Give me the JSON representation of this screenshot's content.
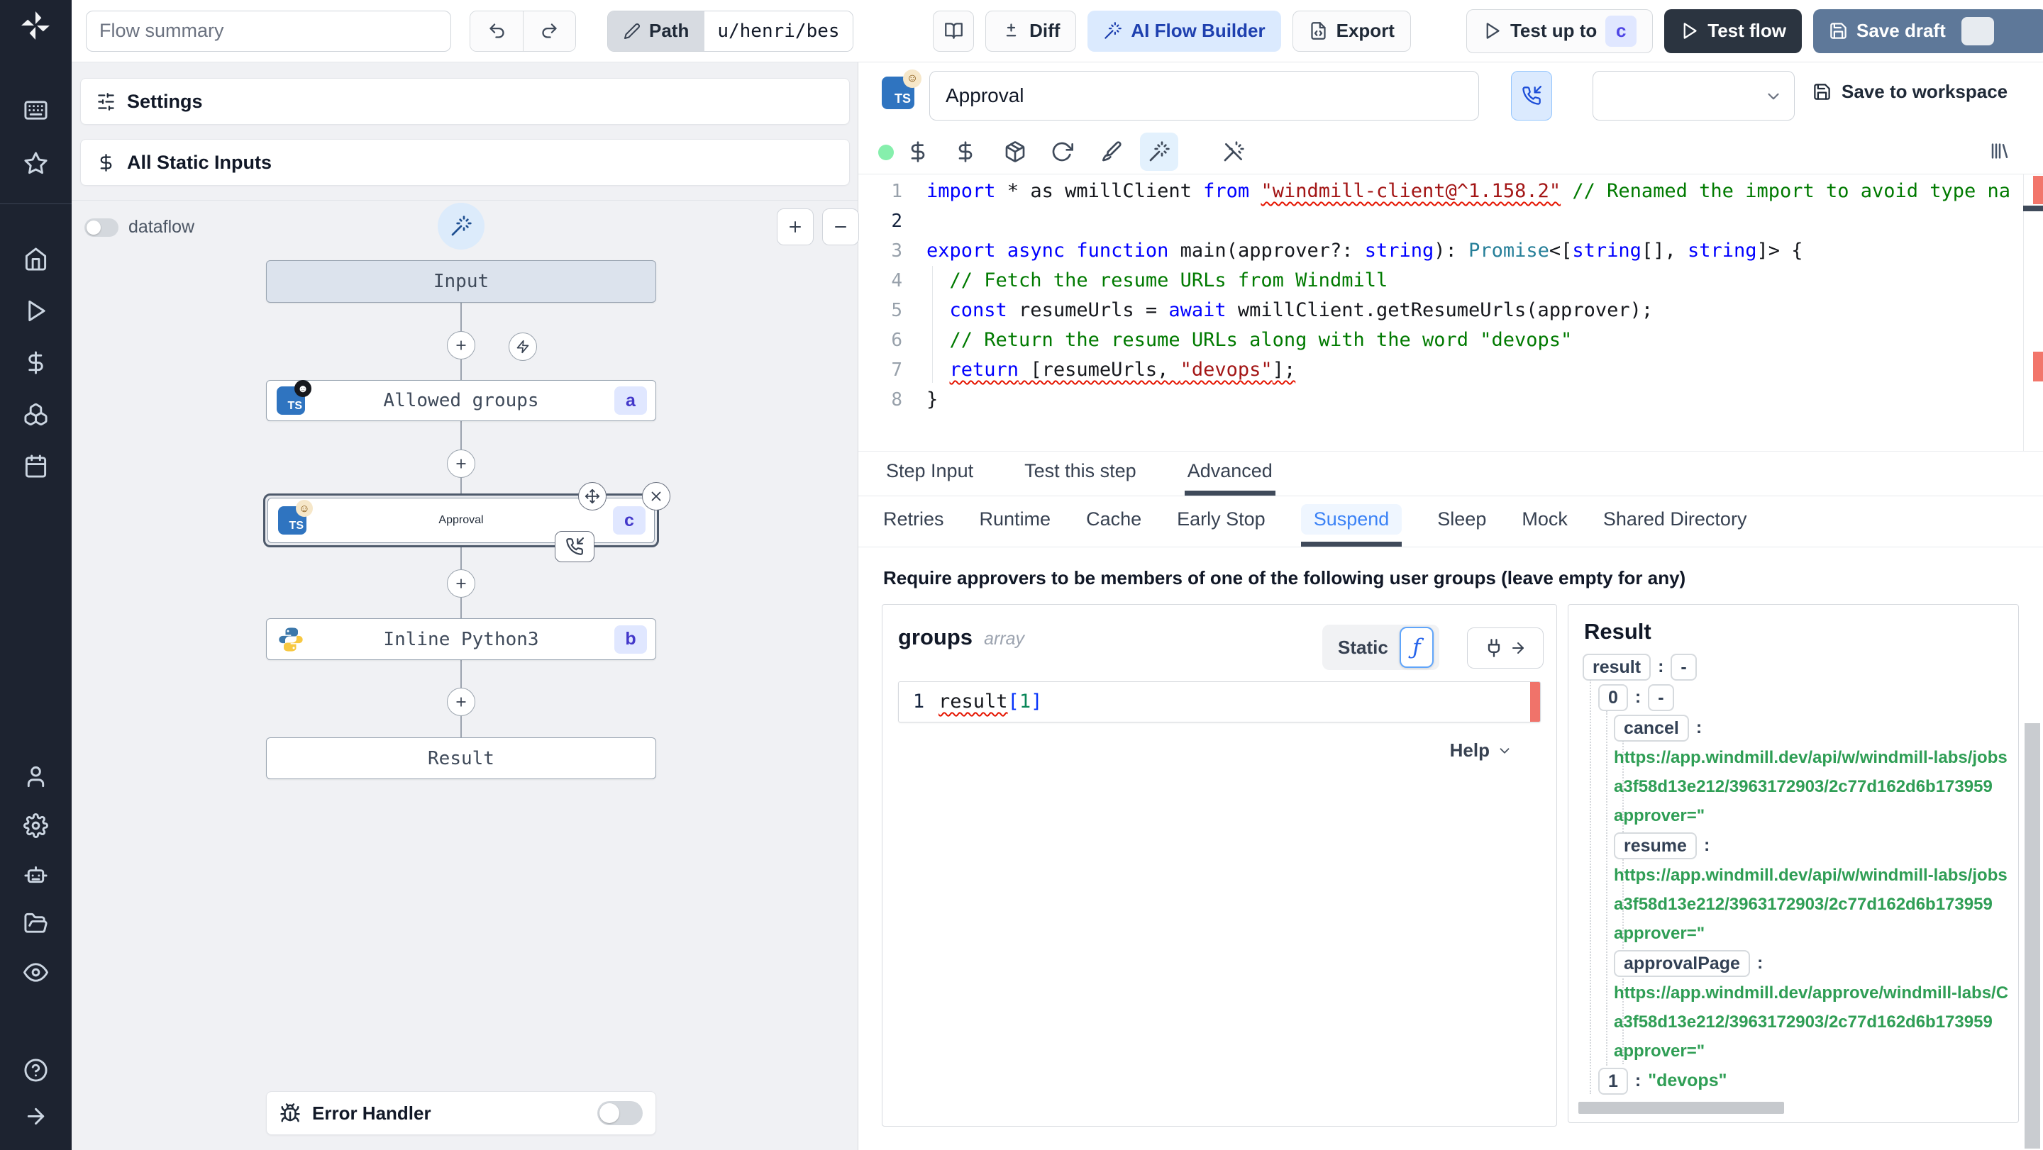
{
  "colors": {
    "accent_blue": "#3b82f6",
    "ai_button_bg": "#dbeafe",
    "ai_button_text": "#1e40af",
    "badge_bg": "#e0e7ff",
    "badge_text": "#4f46e5",
    "test_flow_bg": "#2b3440",
    "save_draft_bg": "#5e7899",
    "status_dot_green": "#86efac",
    "code_keyword": "#0000ff",
    "code_string": "#a31515",
    "code_comment": "#007a00",
    "code_type": "#267f99",
    "url_green": "#2f9e55",
    "error_red": "#e51400"
  },
  "sidebar": {
    "groups": [
      [
        "apps",
        "star"
      ],
      [
        "home",
        "play",
        "dollar",
        "boxes",
        "calendar"
      ],
      [
        "user",
        "gear",
        "robot",
        "folder",
        "eye"
      ],
      [
        "help",
        "arrow-right"
      ]
    ]
  },
  "topbar": {
    "flow_summary_placeholder": "Flow summary",
    "path": {
      "label": "Path",
      "value": "u/henri/bes"
    },
    "buttons": {
      "diff": "Diff",
      "ai_flow_builder": "AI Flow Builder",
      "export": "Export",
      "test_up_to": "Test up to",
      "test_up_to_badge": "c",
      "test_flow": "Test flow",
      "save_draft": "Save draft"
    }
  },
  "flow_panel": {
    "settings_label": "Settings",
    "static_inputs_label": "All Static Inputs",
    "dataflow_label": "dataflow",
    "input_node_label": "Input",
    "result_node_label": "Result",
    "steps": [
      {
        "label": "Allowed groups",
        "badge": "a",
        "lang": "typescript"
      },
      {
        "label": "Approval",
        "badge": "c",
        "lang": "typescript"
      },
      {
        "label": "Inline Python3",
        "badge": "b",
        "lang": "python"
      }
    ],
    "error_handler_label": "Error Handler"
  },
  "step_editor": {
    "name_value": "Approval",
    "save_to_workspace_label": "Save to workspace",
    "toolbar_icons": [
      "dollar",
      "dollar",
      "package",
      "refresh",
      "brush",
      "wand",
      "wand-off"
    ],
    "toolbar_active_index": 5,
    "code": {
      "lines": [
        {
          "segs": [
            {
              "t": "import",
              "c": "kw"
            },
            {
              "t": " * as wmillClient ",
              "c": "pl"
            },
            {
              "t": "from",
              "c": "kw"
            },
            {
              "t": " ",
              "c": "pl"
            },
            {
              "t": "\"windmill-client@^1.158.2\"",
              "c": "str sq"
            },
            {
              "t": " ",
              "c": "pl"
            },
            {
              "t": "// Renamed the import to avoid type na",
              "c": "com"
            }
          ]
        },
        {
          "segs": []
        },
        {
          "segs": [
            {
              "t": "export",
              "c": "kw"
            },
            {
              "t": " ",
              "c": "pl"
            },
            {
              "t": "async",
              "c": "kw"
            },
            {
              "t": " ",
              "c": "pl"
            },
            {
              "t": "function",
              "c": "kw"
            },
            {
              "t": " main(approver?: ",
              "c": "pl"
            },
            {
              "t": "string",
              "c": "kw"
            },
            {
              "t": "): ",
              "c": "pl"
            },
            {
              "t": "Promise",
              "c": "type"
            },
            {
              "t": "<[",
              "c": "pl"
            },
            {
              "t": "string",
              "c": "kw"
            },
            {
              "t": "[], ",
              "c": "pl"
            },
            {
              "t": "string",
              "c": "kw"
            },
            {
              "t": "]> {",
              "c": "pl"
            }
          ]
        },
        {
          "segs": [
            {
              "t": "  // Fetch the resume URLs from Windmill",
              "c": "com"
            }
          ]
        },
        {
          "segs": [
            {
              "t": "  ",
              "c": "pl"
            },
            {
              "t": "const",
              "c": "kw"
            },
            {
              "t": " resumeUrls = ",
              "c": "pl"
            },
            {
              "t": "await",
              "c": "kw"
            },
            {
              "t": " wmillClient.getResumeUrls(approver);",
              "c": "pl"
            }
          ]
        },
        {
          "segs": [
            {
              "t": "  // Return the resume URLs along with the word \"devops\"",
              "c": "com"
            }
          ]
        },
        {
          "segs": [
            {
              "t": "  ",
              "c": "pl"
            },
            {
              "t": "return",
              "c": "kw sq"
            },
            {
              "t": " [resumeUrls, ",
              "c": "pl sq"
            },
            {
              "t": "\"devops\"",
              "c": "str sq"
            },
            {
              "t": "];",
              "c": "pl sq"
            }
          ]
        },
        {
          "segs": [
            {
              "t": "}",
              "c": "pl"
            }
          ]
        }
      ]
    }
  },
  "tabs": {
    "items": [
      "Step Input",
      "Test this step",
      "Advanced"
    ],
    "active": "Advanced"
  },
  "subtabs": {
    "items": [
      "Retries",
      "Runtime",
      "Cache",
      "Early Stop",
      "Suspend",
      "Sleep",
      "Mock",
      "Shared Directory"
    ],
    "active": "Suspend"
  },
  "suspend": {
    "heading": "Require approvers to be members of one of the following user groups (leave empty for any)",
    "field_name": "groups",
    "field_type": "array",
    "static_label": "Static",
    "expr_line_number": "1",
    "expr_segments": [
      {
        "t": "result",
        "c": "pl sq"
      },
      {
        "t": "[",
        "c": "bracket"
      },
      {
        "t": "1",
        "c": "numv"
      },
      {
        "t": "]",
        "c": "bracket"
      }
    ],
    "help_label": "Help"
  },
  "result_panel": {
    "title": "Result",
    "rows": [
      {
        "key": "result",
        "value": "-",
        "value_chip": true,
        "depth": 0
      },
      {
        "key": "0",
        "value": "-",
        "value_chip": true,
        "depth": 1
      },
      {
        "key": "cancel",
        "depth": 2,
        "url_lines": [
          "https://app.windmill.dev/api/w/windmill-labs/jobs",
          "a3f58d13e212/3963172903/2c77d162d6b173959",
          "approver=\""
        ]
      },
      {
        "key": "resume",
        "depth": 2,
        "url_lines": [
          "https://app.windmill.dev/api/w/windmill-labs/jobs",
          "a3f58d13e212/3963172903/2c77d162d6b173959",
          "approver=\""
        ]
      },
      {
        "key": "approvalPage",
        "depth": 2,
        "url_lines": [
          "https://app.windmill.dev/approve/windmill-labs/C",
          "a3f58d13e212/3963172903/2c77d162d6b173959",
          "approver=\""
        ]
      },
      {
        "key": "1",
        "value": "\"devops\"",
        "value_green": true,
        "depth": 1
      }
    ]
  }
}
